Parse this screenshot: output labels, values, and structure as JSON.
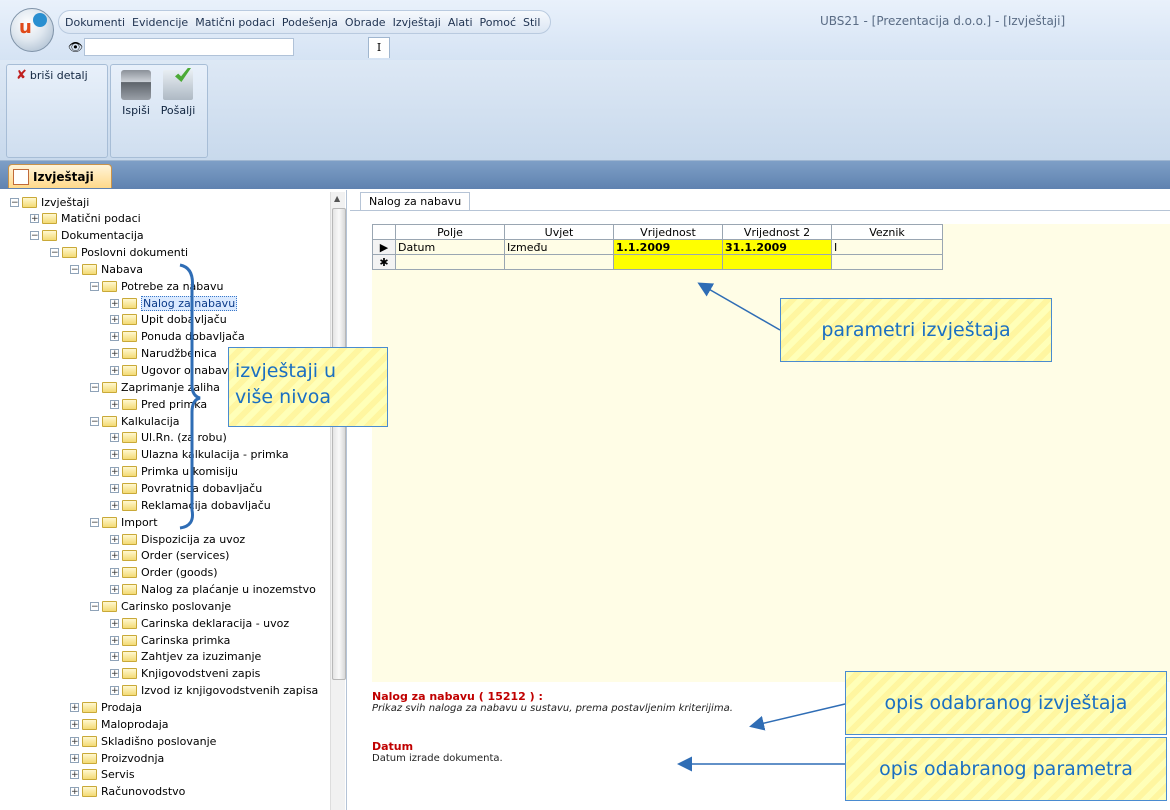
{
  "menu": [
    "Dokumenti",
    "Evidencije",
    "Matični podaci",
    "Podešenja",
    "Obrade",
    "Izvještaji",
    "Alati",
    "Pomoć",
    "Stil"
  ],
  "app_title": "UBS21 - [Prezentacija d.o.o.] - [Izvještaji]",
  "doc_tab": "I",
  "ribbon": {
    "delete_detail": "briši detalj",
    "print": "Ispiši",
    "send": "Pošalji"
  },
  "main_tab": "Izvještaji",
  "tree": [
    {
      "level": 0,
      "pm": "−",
      "label": "Izvještaji"
    },
    {
      "level": 1,
      "pm": "+",
      "label": "Matični podaci"
    },
    {
      "level": 1,
      "pm": "−",
      "label": "Dokumentacija"
    },
    {
      "level": 2,
      "pm": "−",
      "label": "Poslovni dokumenti"
    },
    {
      "level": 3,
      "pm": "−",
      "label": "Nabava"
    },
    {
      "level": 4,
      "pm": "−",
      "label": "Potrebe za nabavu"
    },
    {
      "level": 5,
      "pm": "+",
      "label": "Nalog za nabavu",
      "selected": true
    },
    {
      "level": 5,
      "pm": "+",
      "label": "Upit dobavljaču"
    },
    {
      "level": 5,
      "pm": "+",
      "label": "Ponuda dobavljača"
    },
    {
      "level": 5,
      "pm": "+",
      "label": "Narudžbenica"
    },
    {
      "level": 5,
      "pm": "+",
      "label": "Ugovor o nabavi"
    },
    {
      "level": 4,
      "pm": "−",
      "label": "Zaprimanje zaliha"
    },
    {
      "level": 5,
      "pm": "+",
      "label": "Pred primka"
    },
    {
      "level": 4,
      "pm": "−",
      "label": "Kalkulacija"
    },
    {
      "level": 5,
      "pm": "+",
      "label": "Ul.Rn. (za robu)"
    },
    {
      "level": 5,
      "pm": "+",
      "label": "Ulazna kalkulacija - primka"
    },
    {
      "level": 5,
      "pm": "+",
      "label": "Primka u komisiju"
    },
    {
      "level": 5,
      "pm": "+",
      "label": "Povratnica dobavljaču"
    },
    {
      "level": 5,
      "pm": "+",
      "label": "Reklamacija dobavljaču"
    },
    {
      "level": 4,
      "pm": "−",
      "label": "Import"
    },
    {
      "level": 5,
      "pm": "+",
      "label": "Dispozicija za uvoz"
    },
    {
      "level": 5,
      "pm": "+",
      "label": "Order (services)"
    },
    {
      "level": 5,
      "pm": "+",
      "label": "Order (goods)"
    },
    {
      "level": 5,
      "pm": "+",
      "label": "Nalog za plaćanje u inozemstvo"
    },
    {
      "level": 4,
      "pm": "−",
      "label": "Carinsko poslovanje"
    },
    {
      "level": 5,
      "pm": "+",
      "label": "Carinska deklaracija - uvoz"
    },
    {
      "level": 5,
      "pm": "+",
      "label": "Carinska primka"
    },
    {
      "level": 5,
      "pm": "+",
      "label": "Zahtjev za izuzimanje"
    },
    {
      "level": 5,
      "pm": "+",
      "label": "Knjigovodstveni zapis"
    },
    {
      "level": 5,
      "pm": "+",
      "label": "Izvod iz knjigovodstvenih zapisa"
    },
    {
      "level": 3,
      "pm": "+",
      "label": "Prodaja"
    },
    {
      "level": 3,
      "pm": "+",
      "label": "Maloprodaja"
    },
    {
      "level": 3,
      "pm": "+",
      "label": "Skladišno poslovanje"
    },
    {
      "level": 3,
      "pm": "+",
      "label": "Proizvodnja"
    },
    {
      "level": 3,
      "pm": "+",
      "label": "Servis"
    },
    {
      "level": 3,
      "pm": "+",
      "label": "Računovodstvo"
    }
  ],
  "right_tab": "Nalog za nabavu",
  "grid": {
    "headers": [
      "Polje",
      "Uvjet",
      "Vrijednost",
      "Vrijednost 2",
      "Veznik"
    ],
    "row": [
      "Datum",
      "Između",
      "1.1.2009",
      "31.1.2009",
      "I"
    ]
  },
  "description": {
    "title": "Nalog za nabavu ( 15212 ) :",
    "text": "Prikaz svih naloga za nabavu u sustavu, prema postavljenim kriterijima.",
    "param_title": "Datum",
    "param_text": "Datum izrade dokumenta."
  },
  "callouts": {
    "params": "parametri izvještaja",
    "multilevel_1": "izvještaji u",
    "multilevel_2": "više nivoa",
    "report_desc": "opis odabranog izvještaja",
    "param_desc": "opis odabranog parametra"
  },
  "colors": {
    "callout_text": "#1a6fc2",
    "highlight": "#ffff00",
    "desc_title": "#c00000"
  }
}
